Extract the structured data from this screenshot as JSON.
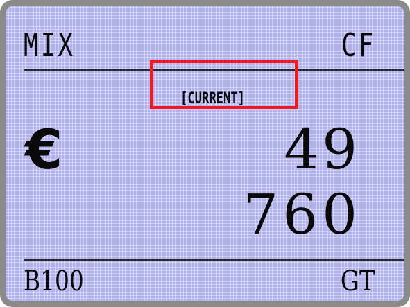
{
  "display": {
    "mode": "MIX",
    "function": "CF",
    "status": "[CURRENT]",
    "currency_symbol": "€",
    "count": "49",
    "amount": "760",
    "batch": "B100",
    "total_mode": "GT"
  },
  "colors": {
    "screen_background": "#b0b0ec",
    "frame": "#8a8a8a",
    "highlight": "#ec1c24",
    "text": "#0a0a0a"
  },
  "icons": {
    "currency": "euro-icon"
  }
}
